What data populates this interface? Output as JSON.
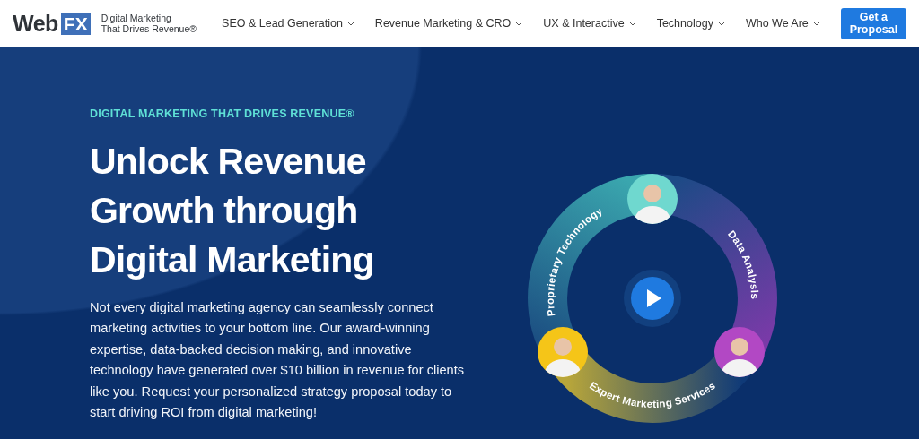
{
  "header": {
    "logo": {
      "word": "Web",
      "mark": "FX"
    },
    "tagline": [
      "Digital Marketing",
      "That Drives Revenue®"
    ],
    "nav": [
      {
        "label": "SEO & Lead Generation"
      },
      {
        "label": "Revenue Marketing & CRO"
      },
      {
        "label": "UX & Interactive"
      },
      {
        "label": "Technology"
      },
      {
        "label": "Who We Are"
      }
    ],
    "cta": "Get a Proposal"
  },
  "hero": {
    "eyebrow": "DIGITAL MARKETING THAT DRIVES REVENUE®",
    "heading": "Unlock Revenue Growth through Digital Marketing",
    "body": "Not every digital marketing agency can seamlessly connect marketing activities to your bottom line. Our award-winning expertise, data-backed decision making, and innovative technology have generated over $10 billion in revenue for clients like you. Request your personalized strategy proposal today to start driving ROI from digital marketing!"
  },
  "wheel": {
    "segments": [
      {
        "label": "Proprietary Technology"
      },
      {
        "label": "Data Analysis"
      },
      {
        "label": "Expert Marketing Services"
      }
    ],
    "avatars": [
      {
        "color": "#6fd8cf"
      },
      {
        "color": "#b248c4"
      },
      {
        "color": "#f5c518"
      }
    ]
  }
}
